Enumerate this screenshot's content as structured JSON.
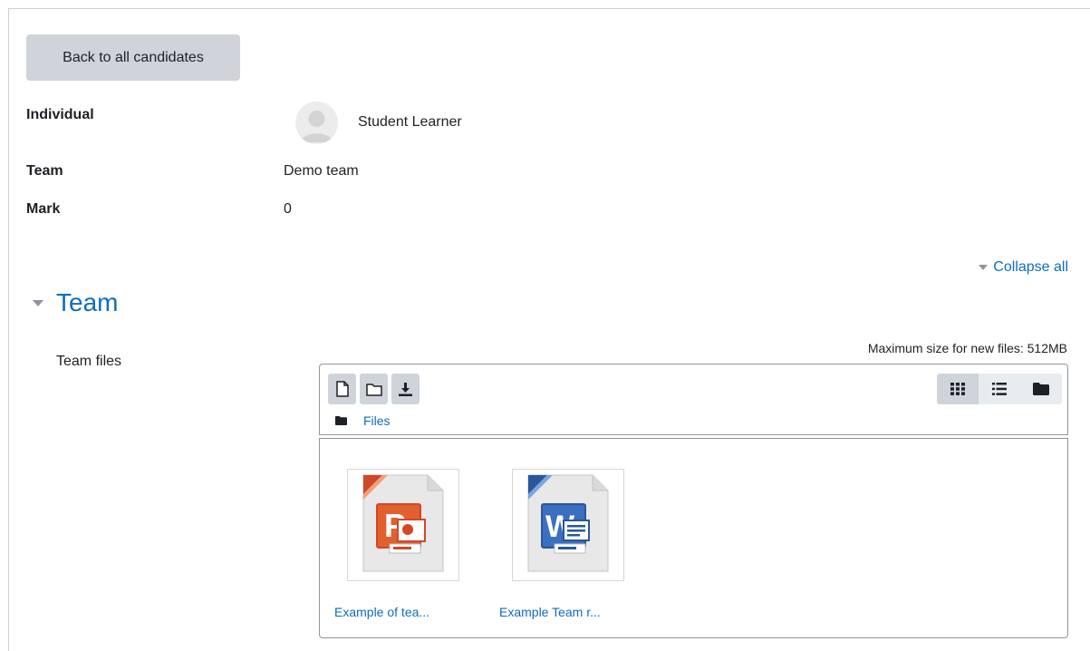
{
  "back_button": "Back to all candidates",
  "details": {
    "individual_label": "Individual",
    "individual_value": "Student Learner",
    "team_label": "Team",
    "team_value": "Demo team",
    "mark_label": "Mark",
    "mark_value": "0"
  },
  "collapse_all": "Collapse all",
  "section": {
    "title": "Team",
    "files_label": "Team files"
  },
  "filemanager": {
    "max_size": "Maximum size for new files: 512MB",
    "path_root": "Files",
    "files": [
      {
        "name": "Example of tea...",
        "icon": "powerpoint-file-icon"
      },
      {
        "name": "Example Team r...",
        "icon": "word-file-icon"
      }
    ]
  },
  "colors": {
    "link": "#0f6cbf",
    "button": "#ced4da",
    "powerpoint": "#d24726",
    "word": "#2b579a"
  }
}
